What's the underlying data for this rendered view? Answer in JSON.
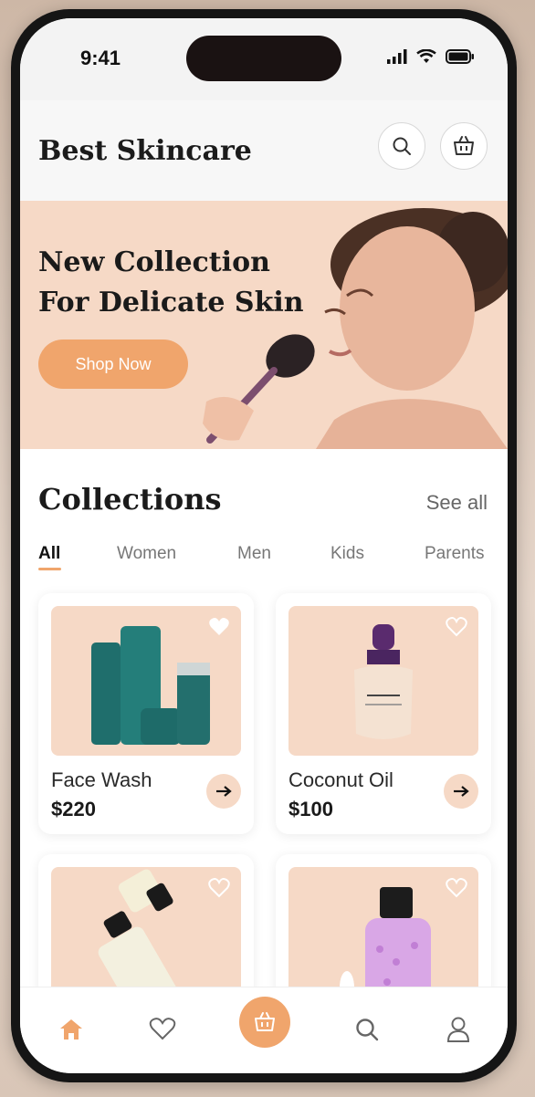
{
  "status_bar": {
    "time": "9:41"
  },
  "header": {
    "title": "Best Skincare",
    "search_icon": "search-icon",
    "cart_icon": "basket-icon"
  },
  "banner": {
    "title": "New Collection For Delicate Skin",
    "button_label": "Shop Now"
  },
  "collections": {
    "title": "Collections",
    "see_all": "See all",
    "tabs": [
      "All",
      "Women",
      "Men",
      "Kids",
      "Parents"
    ],
    "active_tab": "All"
  },
  "products": [
    {
      "name": "Face Wash",
      "price": "$220",
      "favorite": true
    },
    {
      "name": "Coconut Oil",
      "price": "$100",
      "favorite": false
    },
    {
      "name": "",
      "price": "",
      "favorite": false
    },
    {
      "name": "",
      "price": "",
      "favorite": false
    }
  ],
  "colors": {
    "accent": "#f0a56c",
    "banner_bg": "#f6d9c6",
    "text_dark": "#1b1b1b"
  },
  "bottom_nav": [
    "home-icon",
    "heart-icon",
    "basket-icon",
    "search-icon",
    "profile-icon"
  ]
}
